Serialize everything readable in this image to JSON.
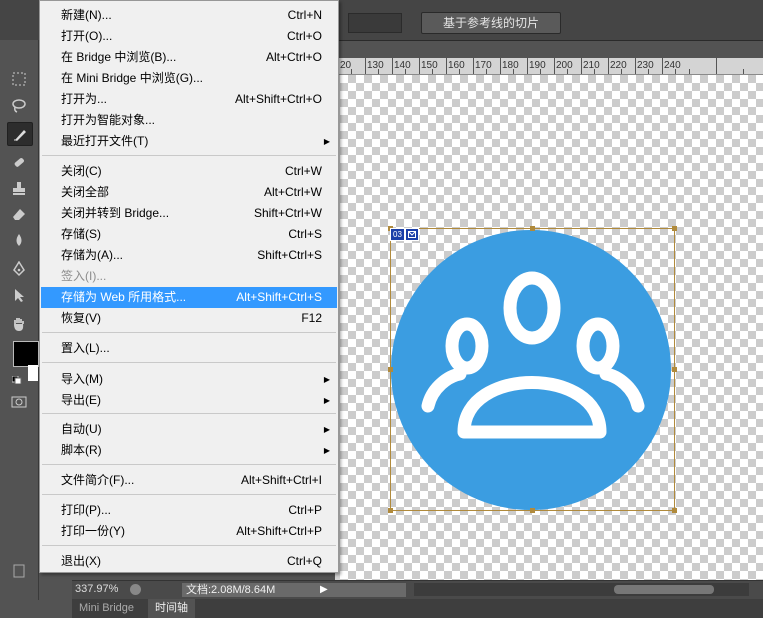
{
  "options_bar": {
    "slice_button_label": "基于参考线的切片"
  },
  "ruler": {
    "top_labels": [
      "20",
      "130",
      "140",
      "150",
      "160",
      "170",
      "180",
      "190",
      "200",
      "210",
      "220",
      "230",
      "240"
    ]
  },
  "menu": {
    "items": [
      {
        "label": "新建(N)...",
        "shortcut": "Ctrl+N"
      },
      {
        "label": "打开(O)...",
        "shortcut": "Ctrl+O"
      },
      {
        "label": "在 Bridge 中浏览(B)...",
        "shortcut": "Alt+Ctrl+O"
      },
      {
        "label": "在 Mini Bridge 中浏览(G)...",
        "shortcut": ""
      },
      {
        "label": "打开为...",
        "shortcut": "Alt+Shift+Ctrl+O"
      },
      {
        "label": "打开为智能对象...",
        "shortcut": ""
      },
      {
        "label": "最近打开文件(T)",
        "shortcut": ""
      },
      {
        "label": "关闭(C)",
        "shortcut": "Ctrl+W"
      },
      {
        "label": "关闭全部",
        "shortcut": "Alt+Ctrl+W"
      },
      {
        "label": "关闭并转到 Bridge...",
        "shortcut": "Shift+Ctrl+W"
      },
      {
        "label": "存储(S)",
        "shortcut": "Ctrl+S"
      },
      {
        "label": "存储为(A)...",
        "shortcut": "Shift+Ctrl+S"
      },
      {
        "label": "签入(I)...",
        "shortcut": ""
      },
      {
        "label": "存储为 Web 所用格式...",
        "shortcut": "Alt+Shift+Ctrl+S"
      },
      {
        "label": "恢复(V)",
        "shortcut": "F12"
      },
      {
        "label": "置入(L)...",
        "shortcut": ""
      },
      {
        "label": "导入(M)",
        "shortcut": ""
      },
      {
        "label": "导出(E)",
        "shortcut": ""
      },
      {
        "label": "自动(U)",
        "shortcut": ""
      },
      {
        "label": "脚本(R)",
        "shortcut": ""
      },
      {
        "label": "文件简介(F)...",
        "shortcut": "Alt+Shift+Ctrl+I"
      },
      {
        "label": "打印(P)...",
        "shortcut": "Ctrl+P"
      },
      {
        "label": "打印一份(Y)",
        "shortcut": "Alt+Shift+Ctrl+P"
      },
      {
        "label": "退出(X)",
        "shortcut": "Ctrl+Q"
      }
    ]
  },
  "slice": {
    "tag_number": "03",
    "tag_icon": "slice-badge-icon"
  },
  "canvas": {
    "icon": "group-users-icon",
    "icon_color": "#3b9de1"
  },
  "status": {
    "zoom": "337.97%",
    "doc_info": "文档:2.08M/8.64M"
  },
  "bottom_tabs": [
    {
      "label": "Mini Bridge"
    },
    {
      "label": "时间轴"
    }
  ],
  "colors": {
    "menu_highlight": "#3399ff",
    "slice_border": "#b08a3c",
    "foreground_swatch": "#000000",
    "background_swatch": "#ffffff"
  }
}
